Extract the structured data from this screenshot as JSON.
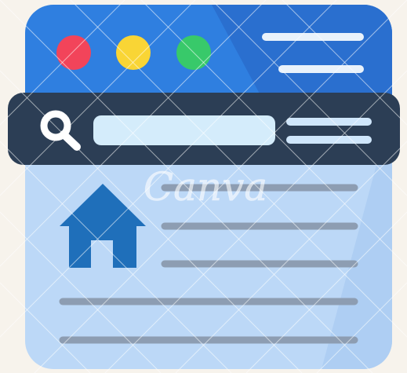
{
  "illustration": {
    "subject": "browser-window-icon",
    "colors": {
      "background": "#f7f3ec",
      "title_bar": "#2f7fe0",
      "title_bar_shade": "#2a6fcf",
      "toolbar": "#2c3e55",
      "content": "#bcd8f7",
      "content_shade": "#aecef3",
      "close_dot": "#f2445a",
      "minimize_dot": "#f9d535",
      "maximize_dot": "#38c96a",
      "address_field": "#d4ecfb",
      "menu_lines_light": "#e9f2fb",
      "menu_lines_dark": "#cfe6fb",
      "search_icon": "#ffffff",
      "home_icon": "#1f6fba",
      "text_lines": "#8d9db2"
    },
    "icons": [
      "window-dots",
      "search-icon",
      "menu-icon",
      "home-icon"
    ]
  },
  "watermark": {
    "text": "Canva"
  }
}
